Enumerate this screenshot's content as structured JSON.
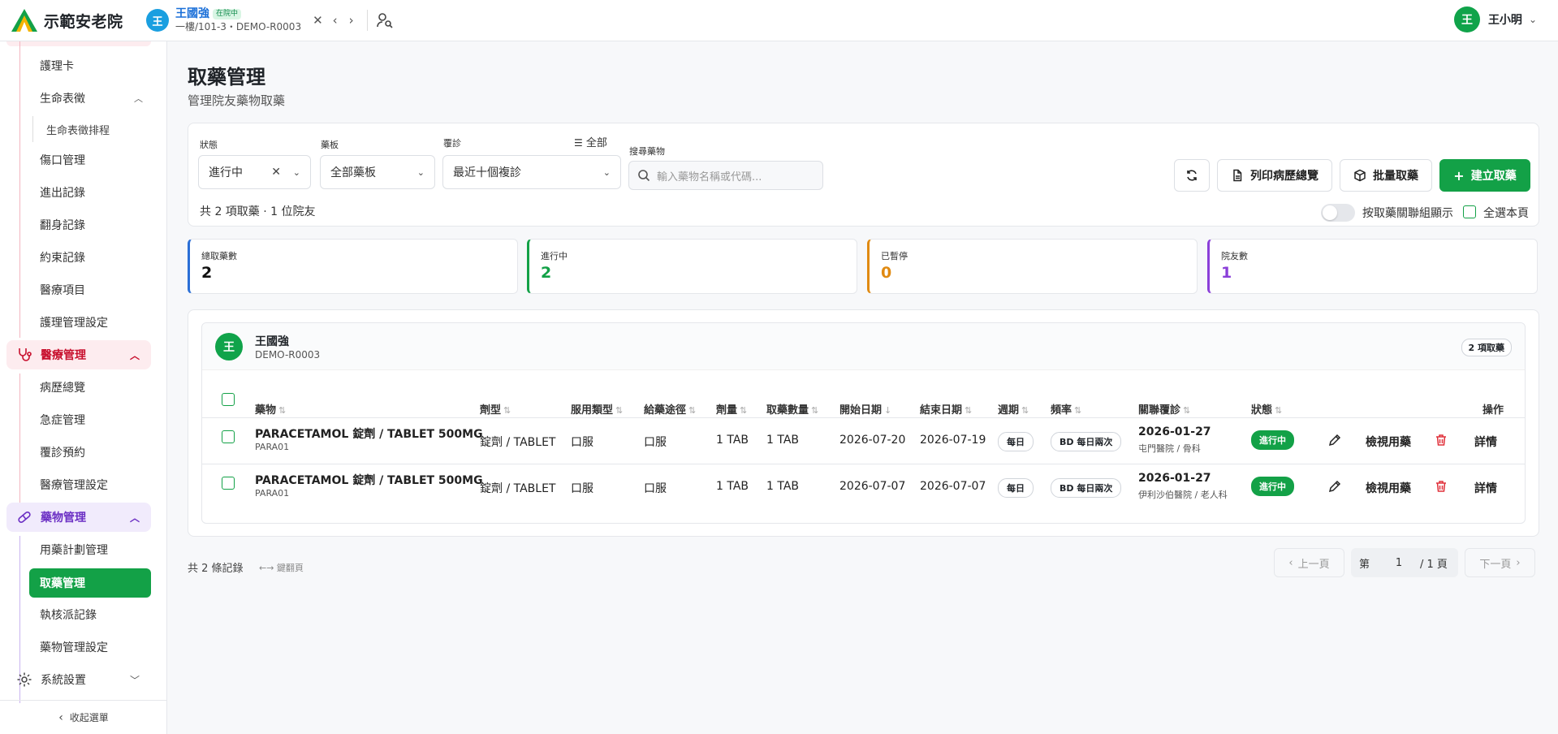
{
  "app": {
    "name": "示範安老院"
  },
  "resident": {
    "initial": "王",
    "name": "王國強",
    "status": "在院中",
    "location": "一樓/101-3・DEMO-R0003"
  },
  "user": {
    "initial": "王",
    "name": "王小明"
  },
  "sidebar": {
    "items": [
      {
        "label": "護理卡"
      },
      {
        "label": "生命表徵"
      },
      {
        "label": "生命表徵排程"
      },
      {
        "label": "傷口管理"
      },
      {
        "label": "進出記錄"
      },
      {
        "label": "翻身記錄"
      },
      {
        "label": "約束記錄"
      },
      {
        "label": "醫療項目"
      },
      {
        "label": "護理管理設定"
      }
    ],
    "medical_group": {
      "label": "醫療管理",
      "items": [
        {
          "label": "病歷總覽"
        },
        {
          "label": "急症管理"
        },
        {
          "label": "覆診預約"
        },
        {
          "label": "醫療管理設定"
        }
      ]
    },
    "drug_group": {
      "label": "藥物管理",
      "items": [
        {
          "label": "用藥計劃管理"
        },
        {
          "label": "取藥管理"
        },
        {
          "label": "執核派記錄"
        },
        {
          "label": "藥物管理設定"
        }
      ]
    },
    "system": {
      "label": "系統設置"
    },
    "collapse_label": "收起選單"
  },
  "page": {
    "title": "取藥管理",
    "subtitle": "管理院友藥物取藥"
  },
  "filters": {
    "status_label": "狀態",
    "status_value": "進行中",
    "board_label": "藥板",
    "board_value": "全部藥板",
    "followup_label": "覆診",
    "followup_value": "最近十個複診",
    "all_label": "全部",
    "search_label": "搜尋藥物",
    "search_placeholder": "輸入藥物名稱或代碼...",
    "summary": "共 2 項取藥 · 1 位院友",
    "group_toggle_label": "按取藥關聯組顯示",
    "select_page_label": "全選本頁"
  },
  "toolbar": {
    "print_label": "列印病歷總覽",
    "batch_label": "批量取藥",
    "create_label": "建立取藥"
  },
  "stats": [
    {
      "label": "總取藥數",
      "value": "2",
      "color": "#2b6fd6"
    },
    {
      "label": "進行中",
      "value": "2",
      "color": "#13a147"
    },
    {
      "label": "已暫停",
      "value": "0",
      "color": "#e08a12"
    },
    {
      "label": "院友數",
      "value": "1",
      "color": "#8b3fd9"
    }
  ],
  "group": {
    "initial": "王",
    "name": "王國強",
    "code": "DEMO-R0003",
    "count": "2 項取藥"
  },
  "table": {
    "headers": [
      "藥物",
      "劑型",
      "服用類型",
      "給藥途徑",
      "劑量",
      "取藥數量",
      "開始日期",
      "結束日期",
      "週期",
      "頻率",
      "關聯覆診",
      "狀態",
      "操作"
    ],
    "rows": [
      {
        "drug": "PARACETAMOL 錠劑 / TABLET 500MG",
        "code": "PARA01",
        "form": "錠劑 / TABLET",
        "type": "口服",
        "route": "口服",
        "dose": "1 TAB",
        "qty": "1 TAB",
        "start": "2026-07-20",
        "end": "2026-07-19",
        "cycle": "每日",
        "freq": "BD 每日兩次",
        "fu_date": "2026-01-27",
        "fu_place": "屯門醫院 / 骨科",
        "status": "進行中",
        "view": "檢視用藥",
        "detail": "詳情"
      },
      {
        "drug": "PARACETAMOL 錠劑 / TABLET 500MG",
        "code": "PARA01",
        "form": "錠劑 / TABLET",
        "type": "口服",
        "route": "口服",
        "dose": "1 TAB",
        "qty": "1 TAB",
        "start": "2026-07-07",
        "end": "2026-07-07",
        "cycle": "每日",
        "freq": "BD 每日兩次",
        "fu_date": "2026-01-27",
        "fu_place": "伊利沙伯醫院 / 老人科",
        "status": "進行中",
        "view": "檢視用藥",
        "detail": "詳情"
      }
    ]
  },
  "footer": {
    "count": "共 2 條記錄",
    "hint": "←→ 鍵翻頁",
    "prev": "上一頁",
    "page_prefix": "第",
    "page_value": "1",
    "page_suffix": "/ 1 頁",
    "next": "下一頁"
  }
}
